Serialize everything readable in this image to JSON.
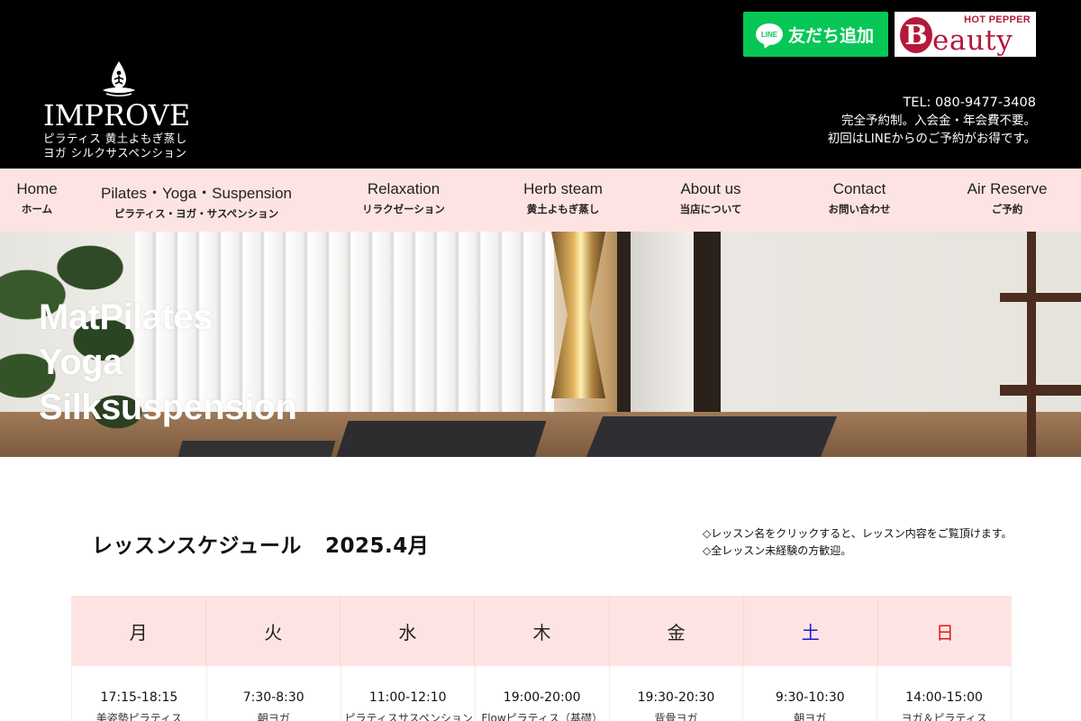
{
  "header": {
    "logo": {
      "word": "IMPROVE",
      "sub_line1": "ピラティス 黄土よもぎ蒸し",
      "sub_line2": "ヨガ シルクサスペンション"
    },
    "line_button": {
      "badge": "LINE",
      "label": "友だち追加"
    },
    "hpb_button": {
      "top": "HOT PEPPER",
      "initial": "B",
      "word": "eauty"
    },
    "contact": {
      "tel": "TEL: 080-9477-3408",
      "line1": "完全予約制。入会金・年会費不要。",
      "line2": "初回はLINEからのご予約がお得です。"
    }
  },
  "nav": {
    "items": [
      {
        "en": "Home",
        "ja": "ホーム"
      },
      {
        "en": "Pilates・Yoga・Suspension",
        "ja": "ピラティス・ヨガ・サスペンション"
      },
      {
        "en": "Relaxation",
        "ja": "リラクゼーション"
      },
      {
        "en": "Herb steam",
        "ja": "黄土よもぎ蒸し"
      },
      {
        "en": "About us",
        "ja": "当店について"
      },
      {
        "en": "Contact",
        "ja": "お問い合わせ"
      },
      {
        "en": "Air Reserve",
        "ja": "ご予約"
      }
    ]
  },
  "hero": {
    "lines": [
      "MatPilates",
      "Yoga",
      "Silksuspension"
    ]
  },
  "schedule": {
    "title": "レッスンスケジュール",
    "month": "2025.4月",
    "notes": [
      "◇レッスン名をクリックすると、レッスン内容をご覧頂けます。",
      "◇全レッスン未経験の方歓迎。"
    ],
    "days": [
      {
        "label": "月",
        "color": "#222222"
      },
      {
        "label": "火",
        "color": "#222222"
      },
      {
        "label": "水",
        "color": "#222222"
      },
      {
        "label": "木",
        "color": "#222222"
      },
      {
        "label": "金",
        "color": "#222222"
      },
      {
        "label": "土",
        "color": "#1a1adb"
      },
      {
        "label": "日",
        "color": "#e01a1a"
      }
    ],
    "slots": [
      {
        "time": "17:15-18:15",
        "name": "美姿勢ピラティス"
      },
      {
        "time": "7:30-8:30",
        "name": "朝ヨガ"
      },
      {
        "time": "11:00-12:10",
        "name": "ピラティスサスペンション"
      },
      {
        "time": "19:00-20:00",
        "name": "Flowピラティス（基礎）"
      },
      {
        "time": "19:30-20:30",
        "name": "背骨ヨガ"
      },
      {
        "time": "9:30-10:30",
        "name": "朝ヨガ"
      },
      {
        "time": "14:00-15:00",
        "name": "ヨガ＆ピラティス"
      }
    ]
  },
  "colors": {
    "header_bg": "#000000",
    "nav_bg": "#fde4e2",
    "line_green": "#06c755",
    "hpb_red": "#b5193a"
  }
}
